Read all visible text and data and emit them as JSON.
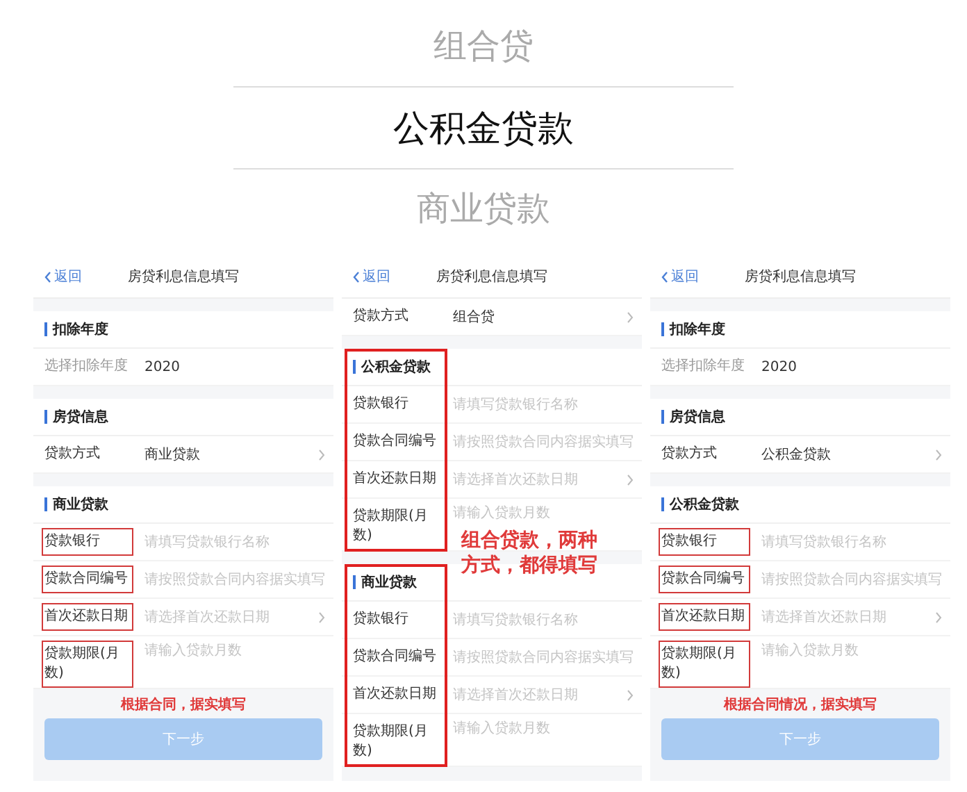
{
  "loan_types": [
    {
      "label": "组合贷",
      "selected": false
    },
    {
      "label": "公积金贷款",
      "selected": true
    },
    {
      "label": "商业贷款",
      "selected": false
    }
  ],
  "screens": [
    {
      "back": "返回",
      "title": "房贷利息信息填写",
      "sections": [
        {
          "title": "扣除年度",
          "outlined": false,
          "rows": [
            {
              "kind": "display",
              "label": "选择扣除年度",
              "value": "2020",
              "outlined": false
            }
          ]
        },
        {
          "title": "房贷信息",
          "outlined": false,
          "rows": [
            {
              "kind": "select",
              "label": "贷款方式",
              "value": "商业贷款",
              "outlined": false
            }
          ]
        },
        {
          "title": "商业贷款",
          "outlined": false,
          "rows": [
            {
              "kind": "input",
              "label": "贷款银行",
              "placeholder": "请填写贷款银行名称",
              "outlined": true
            },
            {
              "kind": "input",
              "label": "贷款合同编号",
              "placeholder": "请按照贷款合同内容据实填写",
              "outlined": true
            },
            {
              "kind": "picker",
              "label": "首次还款日期",
              "placeholder": "请选择首次还款日期",
              "outlined": true
            },
            {
              "kind": "input",
              "label": "贷款期限(月数)",
              "placeholder": "请输入贷款月数",
              "outlined": true
            }
          ]
        }
      ],
      "note": "根据合同，据实填写",
      "button": "下一步"
    },
    {
      "back": "返回",
      "title": "房贷利息信息填写",
      "sections": [
        {
          "outlined": false,
          "rows": [
            {
              "kind": "select",
              "label": "贷款方式",
              "value": "组合贷",
              "outlined": false
            }
          ]
        },
        {
          "title": "公积金贷款",
          "outlined": true,
          "rows": [
            {
              "kind": "input",
              "label": "贷款银行",
              "placeholder": "请填写贷款银行名称",
              "outlined": false
            },
            {
              "kind": "input",
              "label": "贷款合同编号",
              "placeholder": "请按照贷款合同内容据实填写",
              "outlined": false
            },
            {
              "kind": "picker",
              "label": "首次还款日期",
              "placeholder": "请选择首次还款日期",
              "outlined": false
            },
            {
              "kind": "input",
              "label": "贷款期限(月数)",
              "placeholder": "请输入贷款月数",
              "outlined": false
            }
          ]
        },
        {
          "title": "商业贷款",
          "outlined": true,
          "rows": [
            {
              "kind": "input",
              "label": "贷款银行",
              "placeholder": "请填写贷款银行名称",
              "outlined": false
            },
            {
              "kind": "input",
              "label": "贷款合同编号",
              "placeholder": "请按照贷款合同内容据实填写",
              "outlined": false
            },
            {
              "kind": "picker",
              "label": "首次还款日期",
              "placeholder": "请选择首次还款日期",
              "outlined": false
            },
            {
              "kind": "input",
              "label": "贷款期限(月数)",
              "placeholder": "请输入贷款月数",
              "outlined": false
            }
          ]
        }
      ],
      "overlay_note": "组合贷款，两种方式，都得填写"
    },
    {
      "back": "返回",
      "title": "房贷利息信息填写",
      "sections": [
        {
          "title": "扣除年度",
          "outlined": false,
          "rows": [
            {
              "kind": "display",
              "label": "选择扣除年度",
              "value": "2020",
              "outlined": false
            }
          ]
        },
        {
          "title": "房贷信息",
          "outlined": false,
          "rows": [
            {
              "kind": "select",
              "label": "贷款方式",
              "value": "公积金贷款",
              "outlined": false
            }
          ]
        },
        {
          "title": "公积金贷款",
          "outlined": false,
          "rows": [
            {
              "kind": "input",
              "label": "贷款银行",
              "placeholder": "请填写贷款银行名称",
              "outlined": true
            },
            {
              "kind": "input",
              "label": "贷款合同编号",
              "placeholder": "请按照贷款合同内容据实填写",
              "outlined": true
            },
            {
              "kind": "picker",
              "label": "首次还款日期",
              "placeholder": "请选择首次还款日期",
              "outlined": true
            },
            {
              "kind": "input",
              "label": "贷款期限(月数)",
              "placeholder": "请输入贷款月数",
              "outlined": true
            }
          ]
        }
      ],
      "note": "根据合同情况，据实填写",
      "button": "下一步"
    }
  ]
}
